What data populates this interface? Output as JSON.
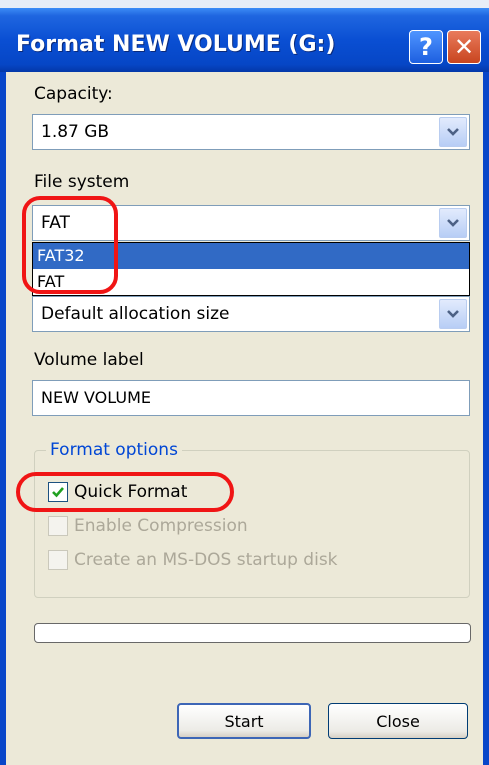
{
  "window": {
    "title": "Format NEW VOLUME (G:)",
    "help_glyph": "?",
    "close_glyph": "✕"
  },
  "capacity": {
    "label": "Capacity:",
    "value": "1.87 GB"
  },
  "file_system": {
    "label": "File system",
    "value": "FAT",
    "options": [
      "FAT32",
      "FAT"
    ],
    "highlighted_option": "FAT32"
  },
  "allocation": {
    "value": "Default allocation size"
  },
  "volume_label": {
    "label": "Volume label",
    "value": "NEW VOLUME"
  },
  "format_options": {
    "legend": "Format options",
    "quick_format": {
      "label": "Quick Format",
      "checked": true,
      "enabled": true
    },
    "enable_compression": {
      "label": "Enable Compression",
      "checked": false,
      "enabled": false
    },
    "msdos_startup": {
      "label": "Create an MS-DOS startup disk",
      "checked": false,
      "enabled": false
    }
  },
  "progress": {
    "percent": 0
  },
  "buttons": {
    "start": "Start",
    "close": "Close"
  },
  "colors": {
    "title_bar": "#0a4fd3",
    "selection": "#316ac5",
    "annotation": "#f01515",
    "group_legend": "#0046d5"
  }
}
